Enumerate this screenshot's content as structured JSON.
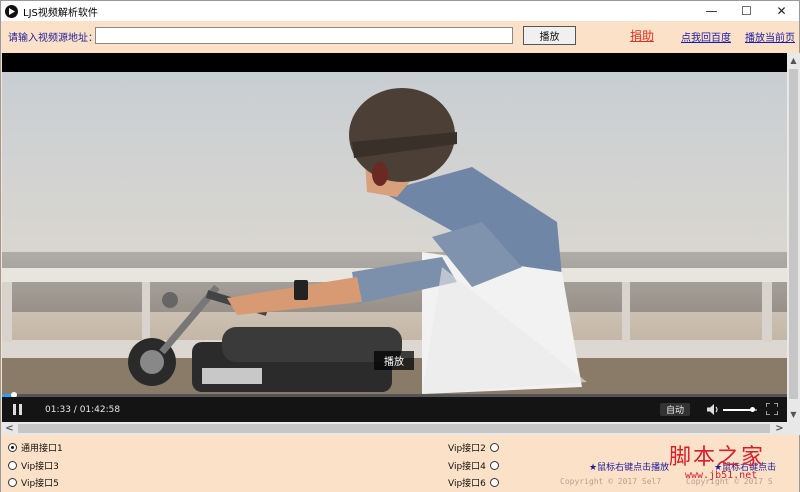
{
  "window": {
    "title": "LJS视频解析软件",
    "controls": {
      "minimize": "—",
      "maximize": "☐",
      "close": "✕"
    }
  },
  "toolbar": {
    "url_label": "请输入视频源地址：",
    "url_value": "",
    "play_button": "播放",
    "donate_link": "捐助",
    "baidu_link": "点我回百度",
    "play_current_link": "播放当前页"
  },
  "player": {
    "play_tip": "播放",
    "time": "01:33 / 01:42:58",
    "quality": "自动",
    "progress": 0.015,
    "volume": 0.85,
    "icons": [
      "pause-icon",
      "volume-icon",
      "fullscreen-icon"
    ]
  },
  "bottom": {
    "radios": [
      {
        "label": "通用接口1",
        "selected": true
      },
      {
        "label": "Vip接口2",
        "selected": false
      },
      {
        "label": "Vip接口3",
        "selected": false
      },
      {
        "label": "Vip接口4",
        "selected": false
      },
      {
        "label": "Vip接口5",
        "selected": false
      },
      {
        "label": "Vip接口6",
        "selected": false
      }
    ],
    "hint_text": "★鼠标右键点击播放",
    "hint_text_2": "★鼠标右键点击",
    "copyright": "Copyright © 2017 Sel7",
    "copyright_2": "Copyright © 2017 S"
  },
  "watermark": {
    "text": "脚本之家",
    "url": "www.jb51.net"
  },
  "colors": {
    "window_bg": "#fbe1c8",
    "link_blue": "#1a1aa6",
    "donate_red": "#e03020",
    "progress_blue": "#31a0ef",
    "watermark_red": "#d81e2a"
  }
}
